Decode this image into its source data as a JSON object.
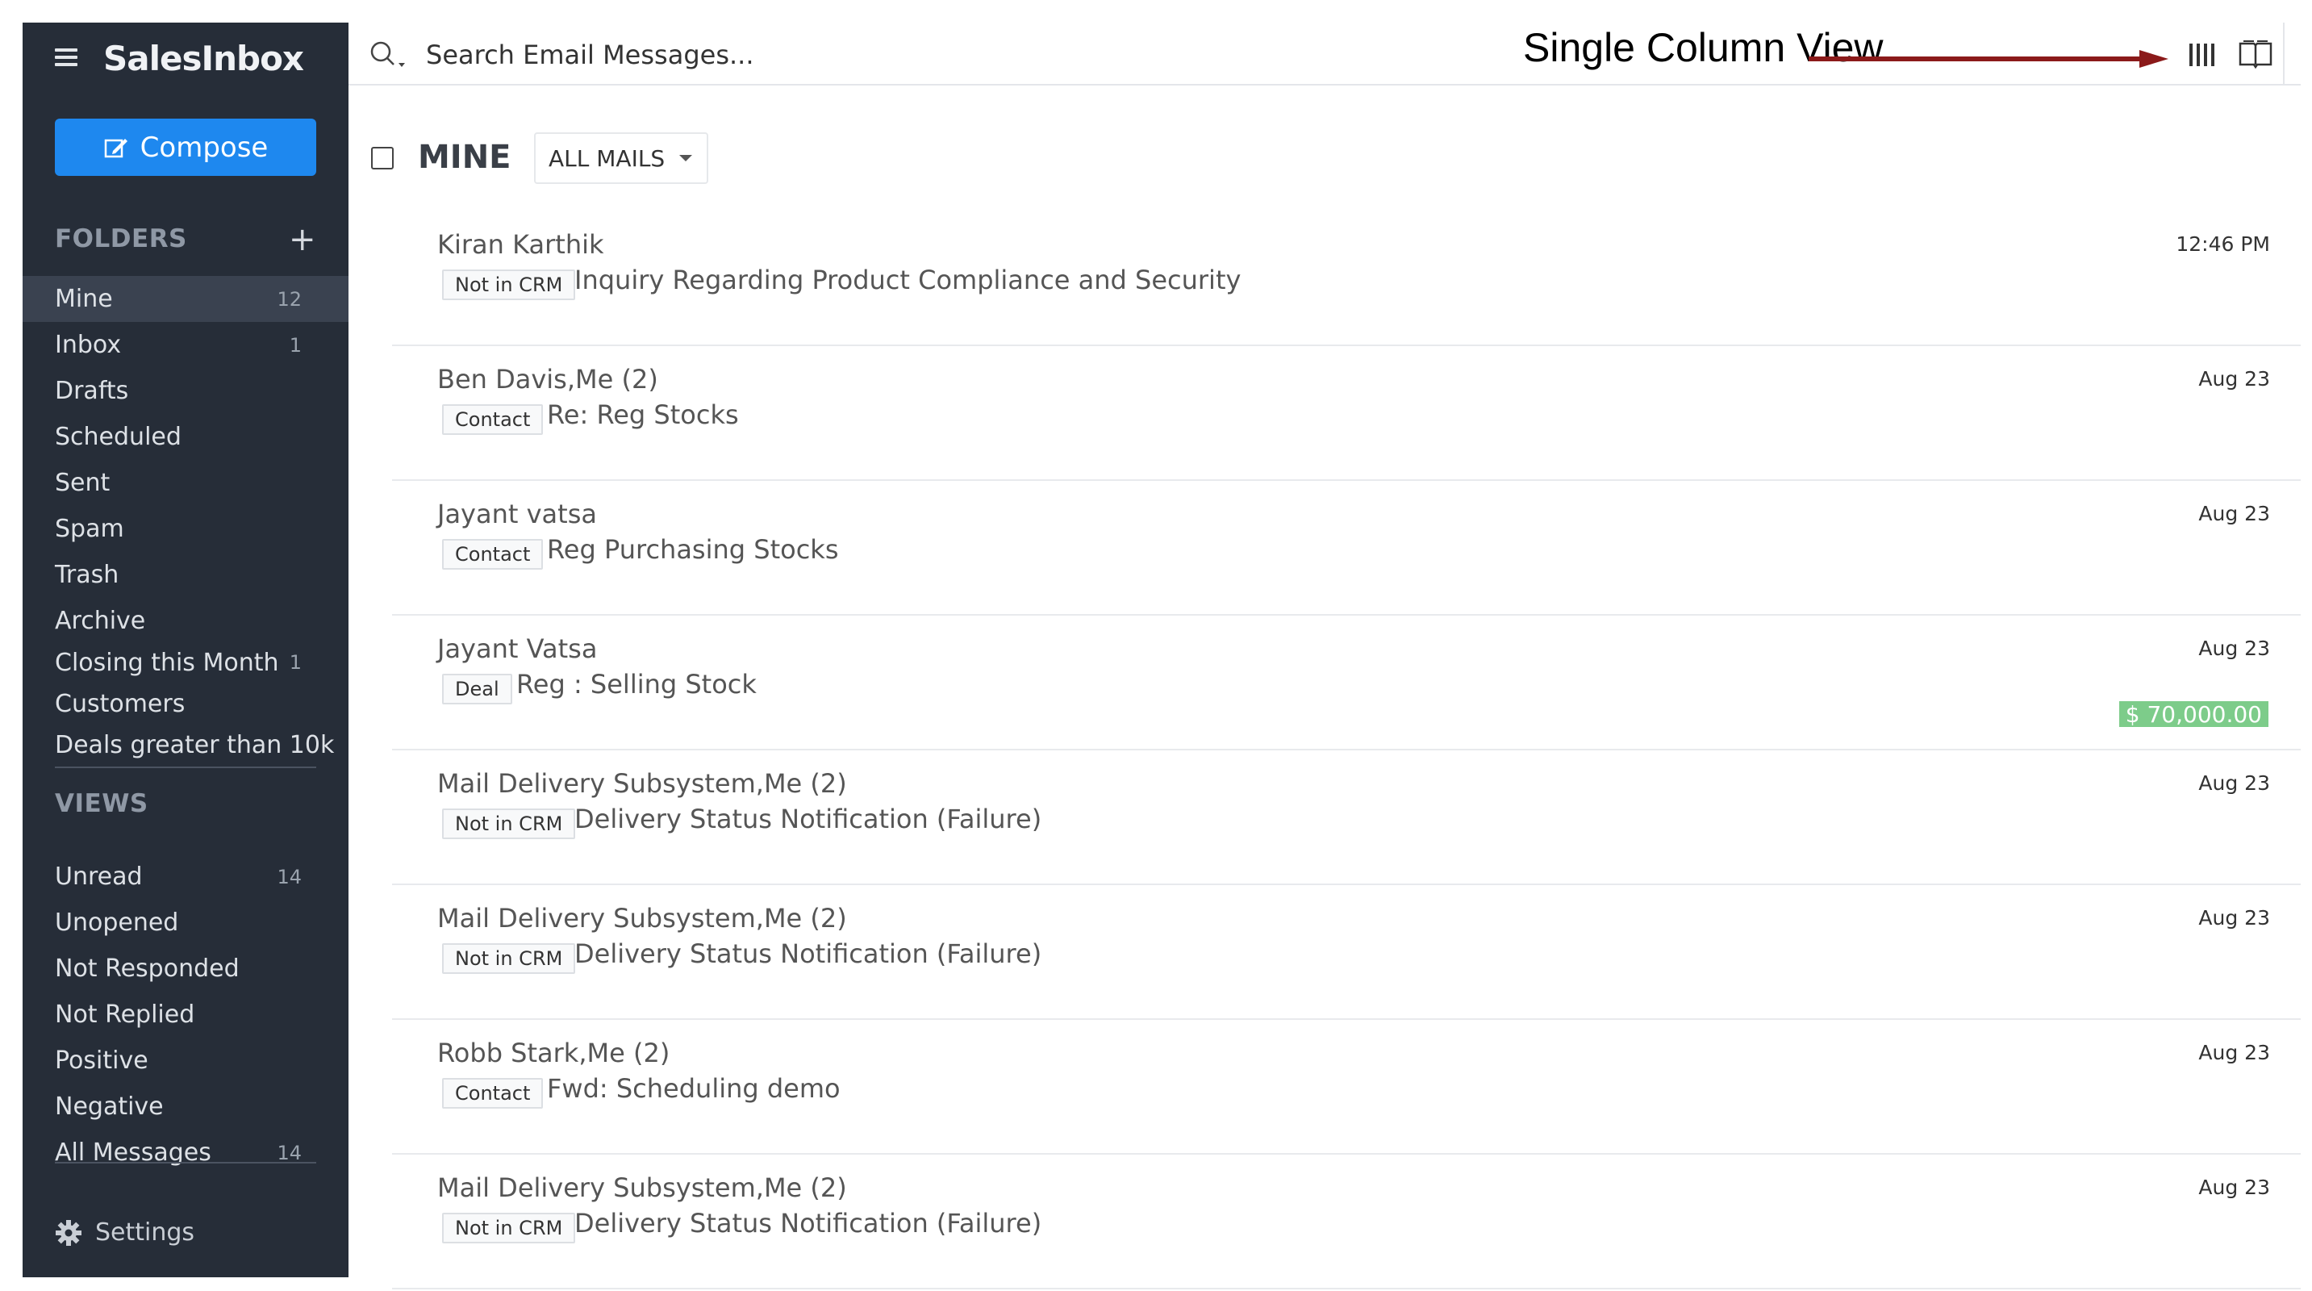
{
  "app": {
    "name": "SalesInbox"
  },
  "sidebar": {
    "compose_label": "Compose",
    "folders_heading": "FOLDERS",
    "folders": [
      {
        "label": "Mine",
        "count": "12"
      },
      {
        "label": "Inbox",
        "count": "1"
      },
      {
        "label": "Drafts",
        "count": ""
      },
      {
        "label": "Scheduled",
        "count": ""
      },
      {
        "label": "Sent",
        "count": ""
      },
      {
        "label": "Spam",
        "count": ""
      },
      {
        "label": "Trash",
        "count": ""
      },
      {
        "label": "Archive",
        "count": ""
      },
      {
        "label": "Closing this Month",
        "count": "1"
      },
      {
        "label": "Customers",
        "count": ""
      },
      {
        "label": "Deals greater than 10k",
        "count": ""
      }
    ],
    "views_heading": "VIEWS",
    "views": [
      {
        "label": "Unread",
        "count": "14"
      },
      {
        "label": "Unopened",
        "count": ""
      },
      {
        "label": "Not Responded",
        "count": ""
      },
      {
        "label": "Not Replied",
        "count": ""
      },
      {
        "label": "Positive",
        "count": ""
      },
      {
        "label": "Negative",
        "count": ""
      },
      {
        "label": "All Messages",
        "count": "14"
      }
    ],
    "settings_label": "Settings"
  },
  "search": {
    "placeholder": "Search Email Messages..."
  },
  "annotation": {
    "callout": "Single Column View"
  },
  "list": {
    "title": "MINE",
    "filter_label": "ALL MAILS",
    "mails": [
      {
        "sender": "Kiran Karthik",
        "tag": "Not in CRM",
        "subject": "Inquiry Regarding Product Compliance and Security",
        "time": "12:46 PM",
        "amount": ""
      },
      {
        "sender": "Ben Davis,Me (2)",
        "tag": "Contact",
        "subject": "Re: Reg Stocks",
        "time": "Aug 23",
        "amount": ""
      },
      {
        "sender": "Jayant vatsa",
        "tag": "Contact",
        "subject": "Reg Purchasing Stocks",
        "time": "Aug 23",
        "amount": ""
      },
      {
        "sender": "Jayant Vatsa",
        "tag": "Deal",
        "subject": "Reg : Selling Stock",
        "time": "Aug 23",
        "amount": "$ 70,000.00"
      },
      {
        "sender": "Mail Delivery Subsystem,Me (2)",
        "tag": "Not in CRM",
        "subject": "Delivery Status Notification (Failure)",
        "time": "Aug 23",
        "amount": ""
      },
      {
        "sender": "Mail Delivery Subsystem,Me (2)",
        "tag": "Not in CRM",
        "subject": "Delivery Status Notification (Failure)",
        "time": "Aug 23",
        "amount": ""
      },
      {
        "sender": "Robb Stark,Me (2)",
        "tag": "Contact",
        "subject": "Fwd: Scheduling demo",
        "time": "Aug 23",
        "amount": ""
      },
      {
        "sender": "Mail Delivery Subsystem,Me (2)",
        "tag": "Not in CRM",
        "subject": "Delivery Status Notification (Failure)",
        "time": "Aug 23",
        "amount": ""
      }
    ]
  },
  "colors": {
    "sidebar_bg": "#262d38",
    "accent": "#1e88ef",
    "amount_bg": "#7dcc8a",
    "arrow": "#8b1a1a"
  }
}
